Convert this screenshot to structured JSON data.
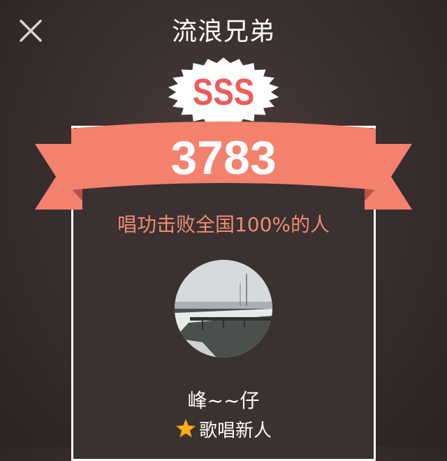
{
  "header": {
    "title": "流浪兄弟",
    "close_icon": "close-icon"
  },
  "result": {
    "grade": "SSS",
    "score": "3783",
    "beat_text": "唱功击败全国100%的人"
  },
  "user": {
    "name": "峰~~仔",
    "level_icon": "star-icon",
    "level": "歌唱新人"
  },
  "colors": {
    "ribbon": "#f4806e",
    "ribbon_dark": "#b8524a",
    "grade_text": "#ef5a5a",
    "beat_text": "#f08a76",
    "star": "#f7b21b"
  }
}
